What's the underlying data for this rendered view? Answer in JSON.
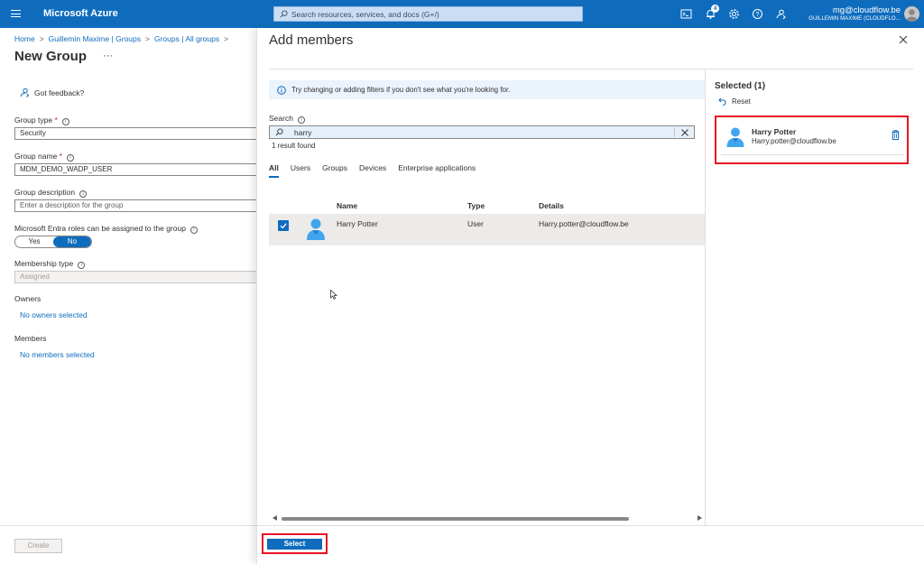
{
  "topbar": {
    "brand": "Microsoft Azure",
    "search_placeholder": "Search resources, services, and docs (G+/)",
    "notification_count": "4",
    "account_email": "mg@cloudflow.be",
    "account_org": "GUILLEMIN MAXIME (CLOUDFLO...",
    "icons": [
      "menu-icon",
      "cloud-shell-icon",
      "notifications-icon",
      "settings-icon",
      "help-icon",
      "feedback-icon"
    ],
    "accent_color": "#0f6cbd"
  },
  "left": {
    "breadcrumb": [
      "Home",
      "Guillemin Maxime | Groups",
      "Groups | All groups"
    ],
    "title": "New Group",
    "more": "···",
    "feedback": "Got feedback?",
    "group_type_label": "Group type",
    "group_type_value": "Security",
    "group_name_label": "Group name",
    "group_name_value": "MDM_DEMO_WADP_USER",
    "group_desc_label": "Group description",
    "group_desc_placeholder": "Enter a description for the group",
    "roles_label": "Microsoft Entra roles can be assigned to the group",
    "roles_yes": "Yes",
    "roles_no": "No",
    "roles_selected": "No",
    "membership_label": "Membership type",
    "membership_value": "Assigned",
    "owners_label": "Owners",
    "owners_link": "No owners selected",
    "members_label": "Members",
    "members_link": "No members selected",
    "create_button": "Create"
  },
  "panel": {
    "title": "Add members",
    "info_text": "Try changing or adding filters if you don't see what you're looking for.",
    "search_label": "Search",
    "search_value": "harry",
    "result_count": "1 result found",
    "tabs": [
      "All",
      "Users",
      "Groups",
      "Devices",
      "Enterprise applications"
    ],
    "active_tab": "All",
    "columns": {
      "name": "Name",
      "type": "Type",
      "details": "Details"
    },
    "rows": [
      {
        "name": "Harry Potter",
        "type": "User",
        "details": "Harry.potter@cloudflow.be",
        "checked": true
      }
    ],
    "selected_title": "Selected (1)",
    "reset": "Reset",
    "selected_items": [
      {
        "name": "Harry Potter",
        "email": "Harry.potter@cloudflow.be"
      }
    ],
    "select_button": "Select",
    "highlight_color": "#e81123"
  }
}
